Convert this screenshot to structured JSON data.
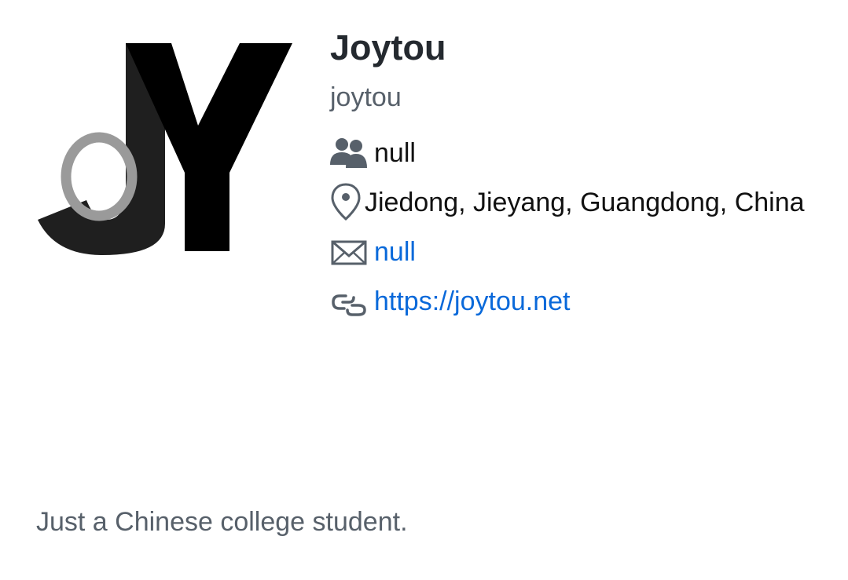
{
  "profile": {
    "display_name": "Joytou",
    "username": "joytou",
    "company": "null",
    "location": "Jiedong, Jieyang, Guangdong, China",
    "email": "null",
    "website": "https://joytou.net",
    "bio": "Just a Chinese college student.",
    "avatar_icon": "jy-logo-avatar"
  },
  "icons": {
    "company": "people-icon",
    "location": "location-pin-icon",
    "email": "mail-icon",
    "website": "link-icon"
  },
  "colors": {
    "name": "#24292f",
    "muted": "#57606a",
    "link": "#0969da",
    "icon": "#57606a"
  }
}
